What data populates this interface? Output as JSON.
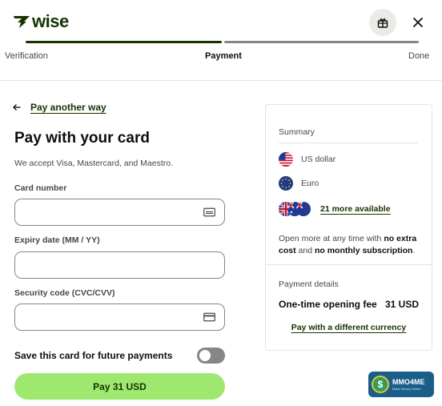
{
  "header": {
    "logo_text": "wise"
  },
  "steps": [
    {
      "label": "Verification"
    },
    {
      "label": "Payment"
    },
    {
      "label": "Done"
    }
  ],
  "back": {
    "label": "Pay another way"
  },
  "form": {
    "title": "Pay with your card",
    "accept_text": "We accept Visa, Mastercard, and Maestro.",
    "card_number_label": "Card number",
    "card_number_value": "",
    "expiry_label": "Expiry date (MM / YY)",
    "expiry_value": "",
    "security_label": "Security code (CVC/CVV)",
    "security_value": "",
    "save_card_label": "Save this card for future payments",
    "save_card_enabled": false,
    "pay_button_label": "Pay 31 USD"
  },
  "summary": {
    "heading": "Summary",
    "currencies": [
      {
        "name": "US dollar",
        "icon": "us-flag-icon"
      },
      {
        "name": "Euro",
        "icon": "eu-flag-icon"
      }
    ],
    "more_available": "21 more available",
    "open_more_prefix": "Open more at any time with ",
    "open_more_bold1": "no extra cost",
    "open_more_mid": " and ",
    "open_more_bold2": "no monthly subscription",
    "open_more_suffix": ".",
    "payment_details_heading": "Payment details",
    "fee_label": "One-time opening fee",
    "fee_value": "31 USD",
    "different_currency_link": "Pay with a different currency"
  },
  "watermark": {
    "main": "MMO4ME",
    "sub": "Make Money Online"
  },
  "colors": {
    "brand_dark": "#163300",
    "brand_green": "#9fe870",
    "muted": "#454745",
    "border": "#868685"
  }
}
